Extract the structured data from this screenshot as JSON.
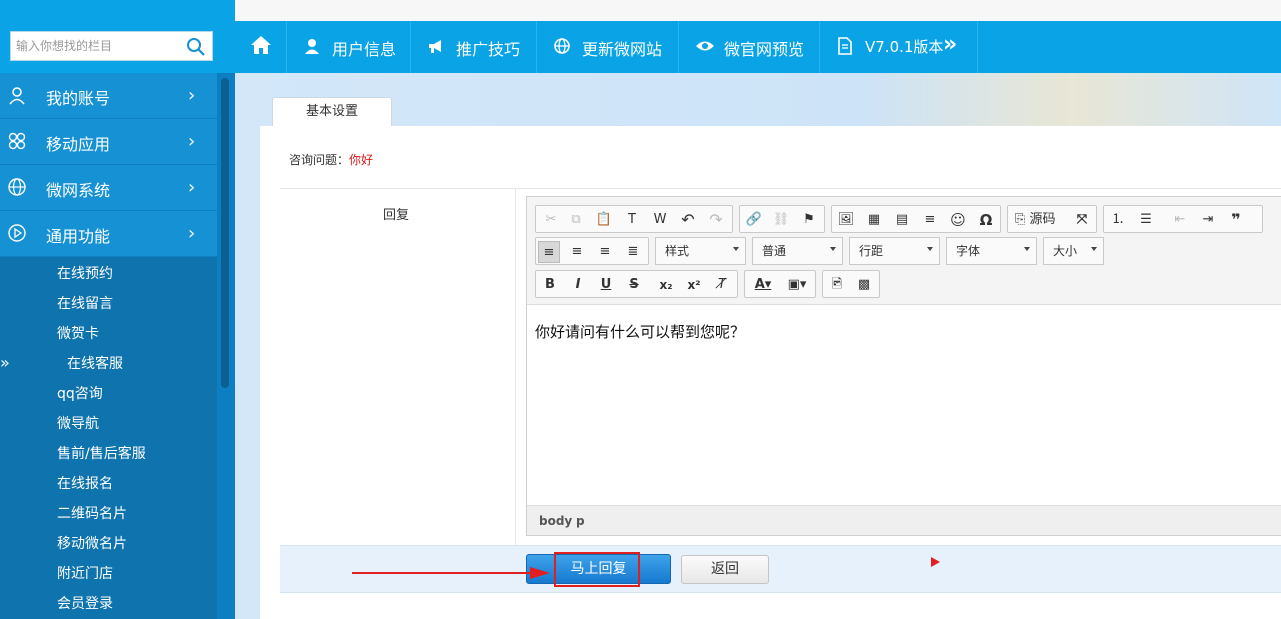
{
  "sidebar": {
    "search_placeholder": "输入你想找的栏目",
    "menus": [
      {
        "label": "我的账号",
        "icon": "user-icon"
      },
      {
        "label": "移动应用",
        "icon": "apps-icon"
      },
      {
        "label": "微网系统",
        "icon": "globe-icon"
      },
      {
        "label": "通用功能",
        "icon": "play-circle-icon"
      }
    ],
    "submenu": [
      "在线预约",
      "在线留言",
      "微贺卡",
      "在线客服",
      "qq咨询",
      "微导航",
      "售前/售后客服",
      "在线报名",
      "二维码名片",
      "移动微名片",
      "附近门店",
      "会员登录"
    ],
    "chevron": "›",
    "expand_glyph": "»"
  },
  "topnav": {
    "items": [
      {
        "label": "",
        "icon": "home-icon"
      },
      {
        "label": "用户信息",
        "icon": "user-icon"
      },
      {
        "label": "推广技巧",
        "icon": "megaphone-icon"
      },
      {
        "label": "更新微网站",
        "icon": "globe-icon"
      },
      {
        "label": "微官网预览",
        "icon": "eye-icon"
      },
      {
        "label": "V7.0.1版本",
        "icon": "document-icon"
      }
    ],
    "more_glyph": "»"
  },
  "tabs": [
    {
      "label": "基本设置"
    }
  ],
  "form": {
    "question_label": "咨询问题：",
    "question_value": "你好",
    "reply_label": "回复"
  },
  "editor": {
    "selects": [
      "样式",
      "普通",
      "行距",
      "字体",
      "大小"
    ],
    "source_label": "源码",
    "content": "你好请问有什么可以帮到您呢？",
    "status_path": [
      "body",
      "p"
    ]
  },
  "actions": {
    "submit_label": "马上回复",
    "back_label": "返回"
  },
  "colors": {
    "nav_blue": "#09a3e6",
    "sidebar_blue": "#1591d4",
    "submenu_blue": "#0f73ad",
    "annotation_red": "#e02020"
  }
}
